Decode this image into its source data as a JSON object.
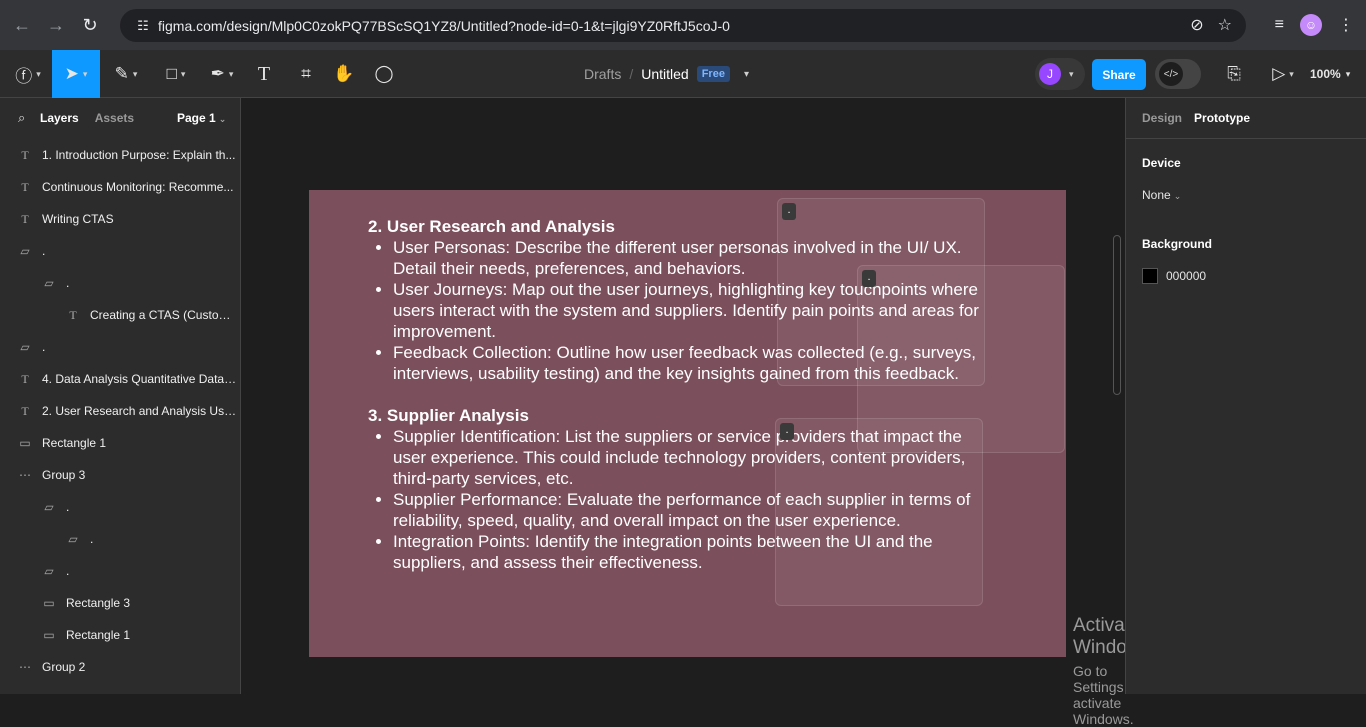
{
  "browser": {
    "url": "figma.com/design/Mlp0C0zokPQ77BScSQ1YZ8/Untitled?node-id=0-1&t=jlgi9YZ0RftJ5coJ-0",
    "profile_initial": "☺"
  },
  "toolbar": {
    "breadcrumb_drafts": "Drafts",
    "breadcrumb_sep": "/",
    "file_title": "Untitled",
    "plan_badge": "Free",
    "user_initial": "J",
    "share_label": "Share",
    "devmode_label": "</>",
    "zoom_label": "100%"
  },
  "left_panel": {
    "tabs": [
      "Layers",
      "Assets"
    ],
    "page_label": "Page 1",
    "layers": [
      {
        "indent": 0,
        "type": "text",
        "name": "1. Introduction Purpose: Explain th..."
      },
      {
        "indent": 0,
        "type": "text",
        "name": "Continuous Monitoring: Recomme..."
      },
      {
        "indent": 0,
        "type": "text",
        "name": "Writing CTAS"
      },
      {
        "indent": 0,
        "type": "frame",
        "name": "."
      },
      {
        "indent": 1,
        "type": "frame",
        "name": "."
      },
      {
        "indent": 2,
        "type": "text",
        "name": "Creating a CTAS (Custom..."
      },
      {
        "indent": 0,
        "type": "frame",
        "name": "."
      },
      {
        "indent": 0,
        "type": "text",
        "name": "4. Data Analysis Quantitative Data:..."
      },
      {
        "indent": 0,
        "type": "text",
        "name": "2. User Research and Analysis Use..."
      },
      {
        "indent": 0,
        "type": "rect",
        "name": "Rectangle 1"
      },
      {
        "indent": 0,
        "type": "group",
        "name": "Group 3"
      },
      {
        "indent": 1,
        "type": "frame",
        "name": "."
      },
      {
        "indent": 2,
        "type": "frame",
        "name": "."
      },
      {
        "indent": 1,
        "type": "frame",
        "name": "."
      },
      {
        "indent": 1,
        "type": "rect",
        "name": "Rectangle 3"
      },
      {
        "indent": 1,
        "type": "rect",
        "name": "Rectangle 1"
      },
      {
        "indent": 0,
        "type": "group",
        "name": "Group 2"
      }
    ]
  },
  "slide": {
    "section1_title": "2. User Research and Analysis",
    "section1_items": [
      "User Personas: Describe the different user personas involved in the UI/ UX. Detail their needs, preferences, and behaviors.",
      "User Journeys: Map out the user journeys, highlighting key touchpoints where users interact with the system and suppliers. Identify pain points and areas for improvement.",
      "Feedback Collection: Outline how user feedback was collected (e.g., surveys, interviews, usability testing) and the key insights gained from this feedback."
    ],
    "section2_title": "3. Supplier Analysis",
    "section2_items": [
      "Supplier Identification: List the suppliers or service providers that impact the user experience. This could include technology providers, content providers, third-party services, etc.",
      "Supplier Performance: Evaluate the performance of each supplier in terms of reliability, speed, quality, and overall impact on the user experience.",
      "Integration Points: Identify the integration points between the UI and the suppliers, and assess their effectiveness."
    ],
    "ghost_label": "."
  },
  "watermark": {
    "title": "Activate Windows",
    "subtitle": "Go to Settings to activate Windows."
  },
  "help_label": "?",
  "right_panel": {
    "tabs": [
      "Design",
      "Prototype"
    ],
    "device_label": "Device",
    "device_value": "None",
    "background_label": "Background",
    "background_hex": "000000",
    "background_color": "#000000"
  },
  "colors": {
    "accent": "#0d99ff",
    "frame_fill": "#7b4f5c",
    "canvas": "#1e1e1e",
    "panel": "#2c2c2c"
  }
}
